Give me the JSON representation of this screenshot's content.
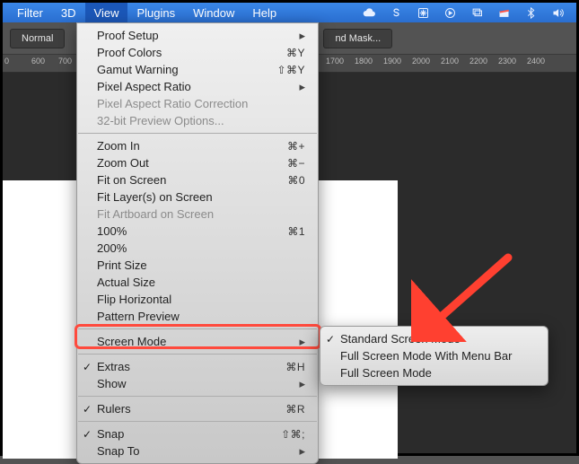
{
  "menubar": {
    "items": [
      "Filter",
      "3D",
      "View",
      "Plugins",
      "Window",
      "Help"
    ],
    "active_index": 2,
    "tray_icons": [
      "cloud-icon",
      "letter-s-icon",
      "snowflake-icon",
      "play-circle-icon",
      "windows-icon",
      "clapper-icon",
      "bluetooth-icon",
      "volume-icon"
    ]
  },
  "optionsbar": {
    "normal_label": "Normal",
    "mask_label": "nd Mask..."
  },
  "ruler": {
    "ticks": [
      "0",
      "600",
      "700",
      "1700",
      "1800",
      "1900",
      "2000",
      "2100",
      "2200",
      "2300",
      "2400"
    ]
  },
  "view_menu": {
    "groups": [
      [
        {
          "label": "Proof Setup",
          "submenu": true
        },
        {
          "label": "Proof Colors",
          "shortcut": "⌘Y"
        },
        {
          "label": "Gamut Warning",
          "shortcut": "⇧⌘Y"
        },
        {
          "label": "Pixel Aspect Ratio",
          "submenu": true
        },
        {
          "label": "Pixel Aspect Ratio Correction",
          "disabled": true
        },
        {
          "label": "32-bit Preview Options...",
          "disabled": true
        }
      ],
      [
        {
          "label": "Zoom In",
          "shortcut": "⌘+"
        },
        {
          "label": "Zoom Out",
          "shortcut": "⌘−"
        },
        {
          "label": "Fit on Screen",
          "shortcut": "⌘0"
        },
        {
          "label": "Fit Layer(s) on Screen"
        },
        {
          "label": "Fit Artboard on Screen",
          "disabled": true
        },
        {
          "label": "100%",
          "shortcut": "⌘1"
        },
        {
          "label": "200%"
        },
        {
          "label": "Print Size"
        },
        {
          "label": "Actual Size"
        },
        {
          "label": "Flip Horizontal"
        },
        {
          "label": "Pattern Preview"
        }
      ],
      [
        {
          "label": "Screen Mode",
          "submenu": true,
          "highlighted": true
        }
      ],
      [
        {
          "label": "Extras",
          "shortcut": "⌘H",
          "checked": true
        },
        {
          "label": "Show",
          "submenu": true
        }
      ],
      [
        {
          "label": "Rulers",
          "shortcut": "⌘R",
          "checked": true
        }
      ],
      [
        {
          "label": "Snap",
          "shortcut": "⇧⌘;",
          "checked": true
        },
        {
          "label": "Snap To",
          "submenu": true
        }
      ]
    ]
  },
  "screen_mode_submenu": {
    "items": [
      {
        "label": "Standard Screen Mode",
        "checked": true
      },
      {
        "label": "Full Screen Mode With Menu Bar"
      },
      {
        "label": "Full Screen Mode"
      }
    ]
  }
}
